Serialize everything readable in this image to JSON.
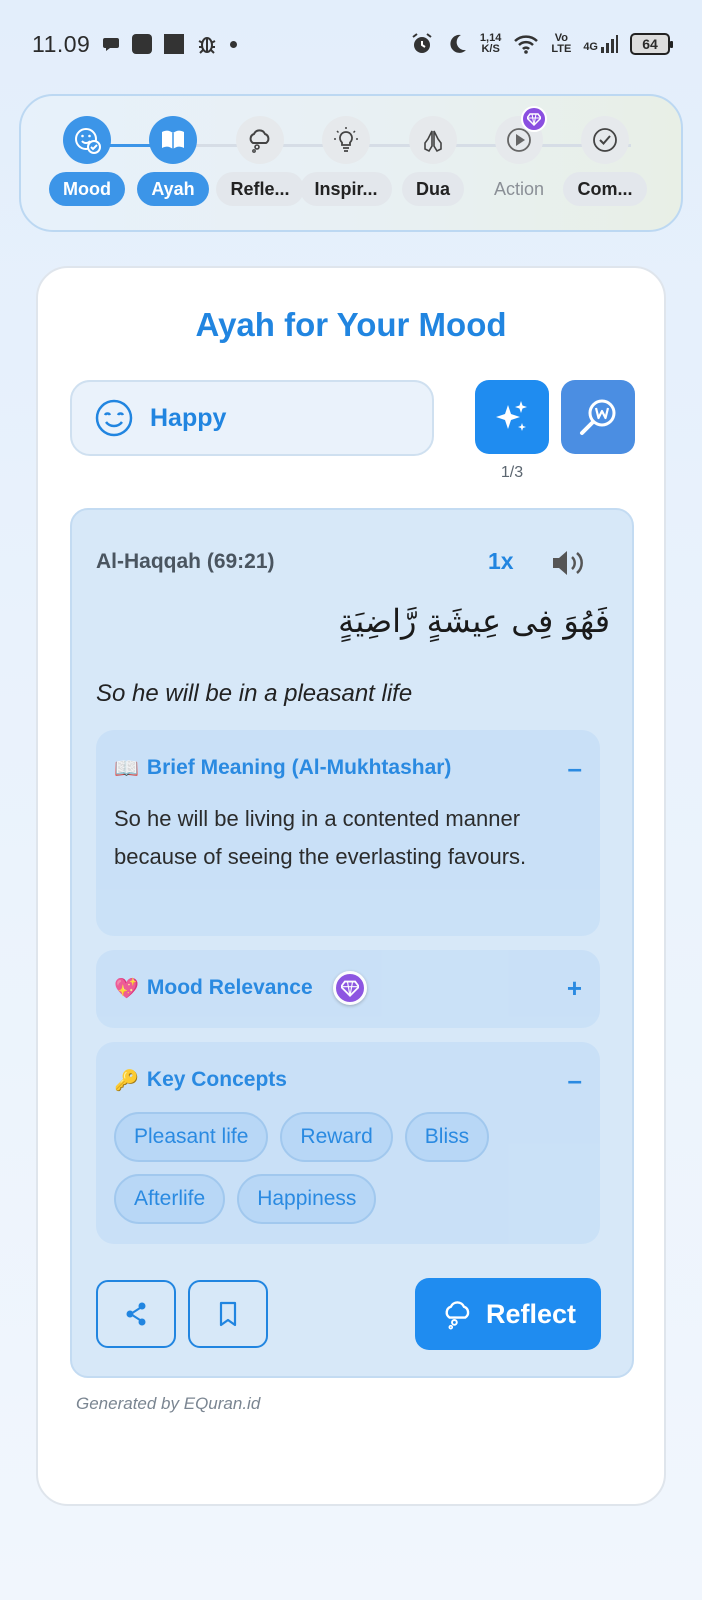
{
  "status_bar": {
    "time": "11.09",
    "net_speed_top": "1,14",
    "net_speed_bottom": "K/S",
    "volte_top": "Vo",
    "volte_bottom": "LTE",
    "network": "4G",
    "battery": "64"
  },
  "stepper": {
    "steps": [
      {
        "label": "Mood",
        "icon": "mood-check-icon",
        "state": "done"
      },
      {
        "label": "Ayah",
        "icon": "quran-book-icon",
        "state": "done"
      },
      {
        "label": "Refle...",
        "icon": "thought-cloud-icon",
        "state": "pending"
      },
      {
        "label": "Inspir...",
        "icon": "lightbulb-icon",
        "state": "pending"
      },
      {
        "label": "Dua",
        "icon": "praying-hands-icon",
        "state": "pending"
      },
      {
        "label": "Action",
        "icon": "play-icon",
        "state": "locked"
      },
      {
        "label": "Com...",
        "icon": "check-circle-icon",
        "state": "pending"
      }
    ]
  },
  "card": {
    "title": "Ayah for Your Mood",
    "mood": "Happy",
    "counter": "1/3"
  },
  "ayah": {
    "reference": "Al-Haqqah (69:21)",
    "speed": "1x",
    "arabic": "فَهُوَ فِى عِيشَةٍ رَّاضِيَةٍ",
    "translation": "So he will be in a pleasant life"
  },
  "sections": {
    "meaning": {
      "emoji": "📖",
      "title": "Brief Meaning (Al-Mukhtashar)",
      "toggle": "–",
      "text": "So he will be living in a contented manner because of seeing the everlasting favours."
    },
    "relevance": {
      "emoji": "💖",
      "title": "Mood Relevance",
      "toggle": "+"
    },
    "concepts": {
      "emoji": "🔑",
      "title": "Key Concepts",
      "toggle": "–",
      "chips": [
        "Pleasant life",
        "Reward",
        "Bliss",
        "Afterlife",
        "Happiness"
      ]
    }
  },
  "actions": {
    "reflect_label": "Reflect"
  },
  "footer": "Generated by EQuran.id",
  "colors": {
    "accent": "#2185e0",
    "button": "#1f8cf0",
    "premium": "#8a4fe0",
    "panel": "#d7e8f8"
  }
}
